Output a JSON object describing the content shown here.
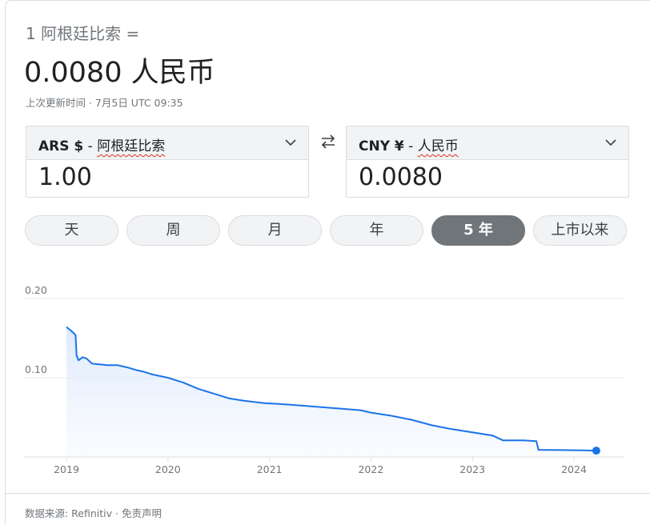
{
  "header": {
    "from_amount_line": "1 阿根廷比索 =",
    "result": "0.0080 人民币",
    "updated": "上次更新时间 · 7月5日 UTC 09:35"
  },
  "converter": {
    "from": {
      "code": "ARS $",
      "sep": " - ",
      "name": "阿根廷比索",
      "value": "1.00"
    },
    "to": {
      "code": "CNY ¥",
      "sep": " - ",
      "name": "人民币",
      "value": "0.0080"
    },
    "swap_icon": "swap-horiz-arrows-icon",
    "dropdown_icon": "chevron-down-icon"
  },
  "tabs": [
    {
      "label": "天",
      "active": false
    },
    {
      "label": "周",
      "active": false
    },
    {
      "label": "月",
      "active": false
    },
    {
      "label": "年",
      "active": false
    },
    {
      "label": "5 年",
      "active": true
    },
    {
      "label": "上市以来",
      "active": false
    }
  ],
  "chart_data": {
    "type": "area",
    "title": "",
    "xlabel": "",
    "ylabel": "",
    "x_ticks": [
      "2019",
      "2020",
      "2021",
      "2022",
      "2023",
      "2024"
    ],
    "y_ticks": [
      0.1,
      0.2
    ],
    "y_tick_labels": [
      "0.10",
      "0.20"
    ],
    "ylim": [
      0.0,
      0.2
    ],
    "xlim": [
      2018.6,
      2024.6
    ],
    "grid": true,
    "line_color": "#1a73e8",
    "fill_color": "#e8f0fe",
    "series": [
      {
        "x": [
          2019.0,
          2019.04,
          2019.09,
          2019.1,
          2019.12,
          2019.16,
          2019.2,
          2019.25,
          2019.32,
          2019.4,
          2019.5,
          2019.6,
          2019.68,
          2019.75,
          2019.85,
          2020.0,
          2020.15,
          2020.3,
          2020.45,
          2020.6,
          2020.75,
          2020.95,
          2021.1,
          2021.3,
          2021.5,
          2021.7,
          2021.9,
          2022.0,
          2022.2,
          2022.4,
          2022.6,
          2022.8,
          2023.0,
          2023.2,
          2023.3,
          2023.35,
          2023.5,
          2023.63,
          2023.65,
          2023.9,
          2024.1,
          2024.22
        ],
        "y": [
          0.164,
          0.16,
          0.154,
          0.128,
          0.122,
          0.126,
          0.124,
          0.118,
          0.117,
          0.116,
          0.116,
          0.113,
          0.11,
          0.108,
          0.104,
          0.1,
          0.094,
          0.086,
          0.08,
          0.074,
          0.071,
          0.068,
          0.067,
          0.065,
          0.063,
          0.061,
          0.059,
          0.056,
          0.052,
          0.047,
          0.04,
          0.035,
          0.031,
          0.027,
          0.021,
          0.021,
          0.021,
          0.02,
          0.009,
          0.0087,
          0.0084,
          0.008
        ]
      }
    ],
    "end_point": {
      "x": 2024.22,
      "y": 0.008
    }
  },
  "footer": {
    "source": "数据来源: Refinitiv",
    "separator": " · ",
    "disclaimer": "免责声明"
  }
}
